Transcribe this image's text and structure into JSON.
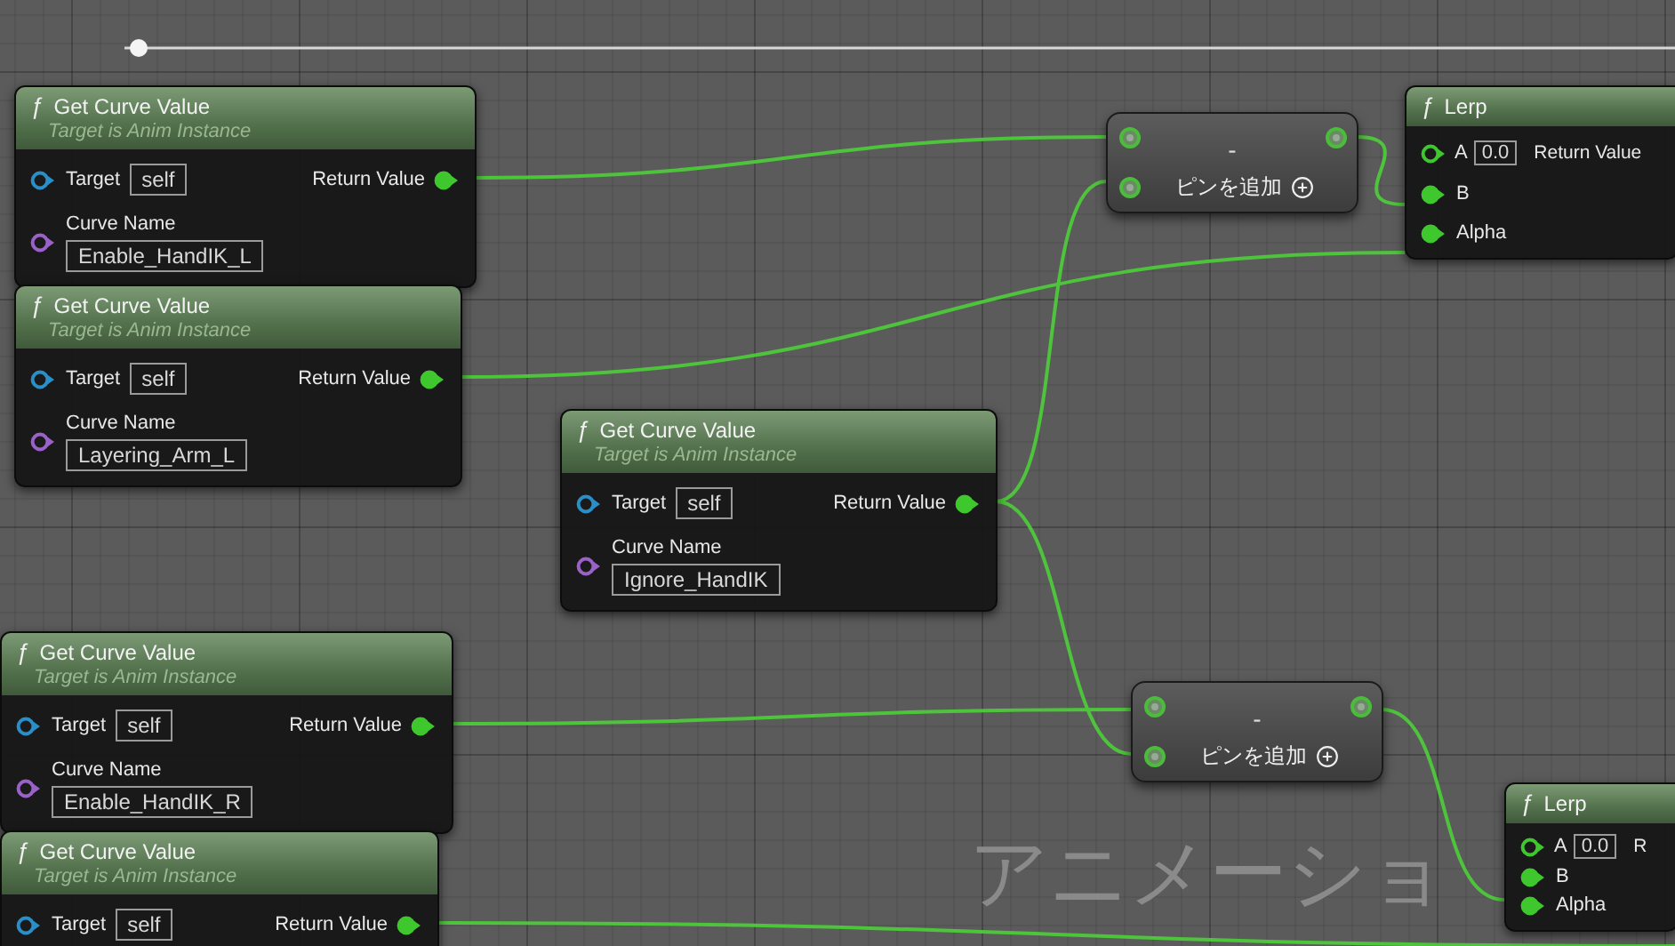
{
  "graph_label": "アニメーショ",
  "nodes": [
    {
      "kind": "get_curve",
      "icon": "ƒ",
      "title": "Get Curve Value",
      "subtitle": "Target is Anim Instance",
      "target_label": "Target",
      "target_value": "self",
      "output_label": "Return Value",
      "curve_label": "Curve Name",
      "curve_value": "Enable_HandIK_L"
    },
    {
      "kind": "get_curve",
      "icon": "ƒ",
      "title": "Get Curve Value",
      "subtitle": "Target is Anim Instance",
      "target_label": "Target",
      "target_value": "self",
      "output_label": "Return Value",
      "curve_label": "Curve Name",
      "curve_value": "Layering_Arm_L"
    },
    {
      "kind": "get_curve",
      "icon": "ƒ",
      "title": "Get Curve Value",
      "subtitle": "Target is Anim Instance",
      "target_label": "Target",
      "target_value": "self",
      "output_label": "Return Value",
      "curve_label": "Curve Name",
      "curve_value": "Ignore_HandIK"
    },
    {
      "kind": "get_curve",
      "icon": "ƒ",
      "title": "Get Curve Value",
      "subtitle": "Target is Anim Instance",
      "target_label": "Target",
      "target_value": "self",
      "output_label": "Return Value",
      "curve_label": "Curve Name",
      "curve_value": "Enable_HandIK_R"
    },
    {
      "kind": "get_curve",
      "icon": "ƒ",
      "title": "Get Curve Value",
      "subtitle": "Target is Anim Instance",
      "target_label": "Target",
      "target_value": "self",
      "output_label": "Return Value"
    },
    {
      "kind": "subtract",
      "symbol": "-",
      "add_pin_label": "ピンを追加"
    },
    {
      "kind": "lerp",
      "icon": "ƒ",
      "title": "Lerp",
      "a_label": "A",
      "a_value": "0.0",
      "b_label": "B",
      "alpha_label": "Alpha",
      "output_label": "Return Value"
    },
    {
      "kind": "subtract",
      "symbol": "-",
      "add_pin_label": "ピンを追加"
    },
    {
      "kind": "lerp",
      "icon": "ƒ",
      "title": "Lerp",
      "a_label": "A",
      "a_value": "0.0",
      "b_label": "B",
      "alpha_label": "Alpha",
      "output_label": "R"
    }
  ]
}
